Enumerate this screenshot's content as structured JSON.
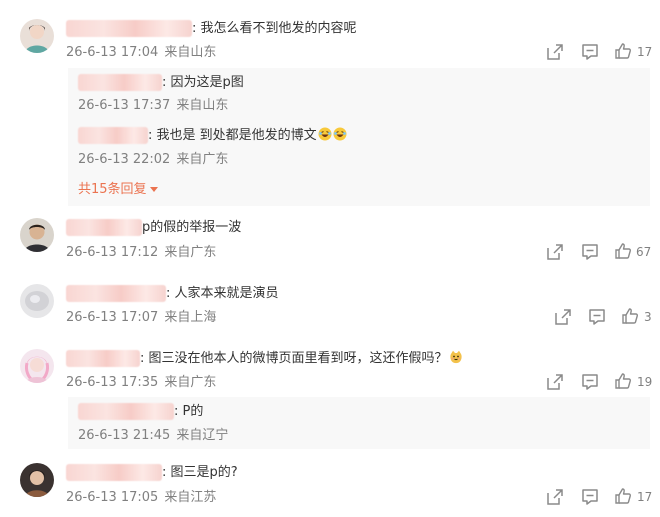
{
  "comments": [
    {
      "text": ": 我怎么看不到他发的内容呢",
      "time": "26-6-13 17:04",
      "location": "来自山东",
      "likes": "17",
      "replies": [
        {
          "text": ": 因为这是p图",
          "time": "26-6-13 17:37",
          "location": "来自山东"
        },
        {
          "text": ": 我也是 到处都是他发的博文",
          "emoji": [
            "laugh-cry-emoji",
            "laugh-cry-emoji"
          ],
          "time": "26-6-13 22:02",
          "location": "来自广东"
        }
      ],
      "more_replies": "共15条回复"
    },
    {
      "text": "p的假的举报一波",
      "time": "26-6-13 17:12",
      "location": "来自广东",
      "likes": "67"
    },
    {
      "text": ": 人家本来就是演员",
      "time": "26-6-13 17:07",
      "location": "来自上海",
      "likes": "3"
    },
    {
      "text": ": 图三没在他本人的微博页面里看到呀，这还作假吗？",
      "emoji": [
        "cat-emoji"
      ],
      "time": "26-6-13 17:35",
      "location": "来自广东",
      "likes": "19",
      "replies": [
        {
          "text": ": P的",
          "time": "26-6-13 21:45",
          "location": "来自辽宁"
        }
      ]
    },
    {
      "text": ": 图三是p的?",
      "time": "26-6-13 17:05",
      "location": "来自江苏",
      "likes": "17"
    }
  ],
  "colors": {
    "meta": "#808080",
    "accent": "#eb7350",
    "reply_bg": "#f8f8f8"
  }
}
